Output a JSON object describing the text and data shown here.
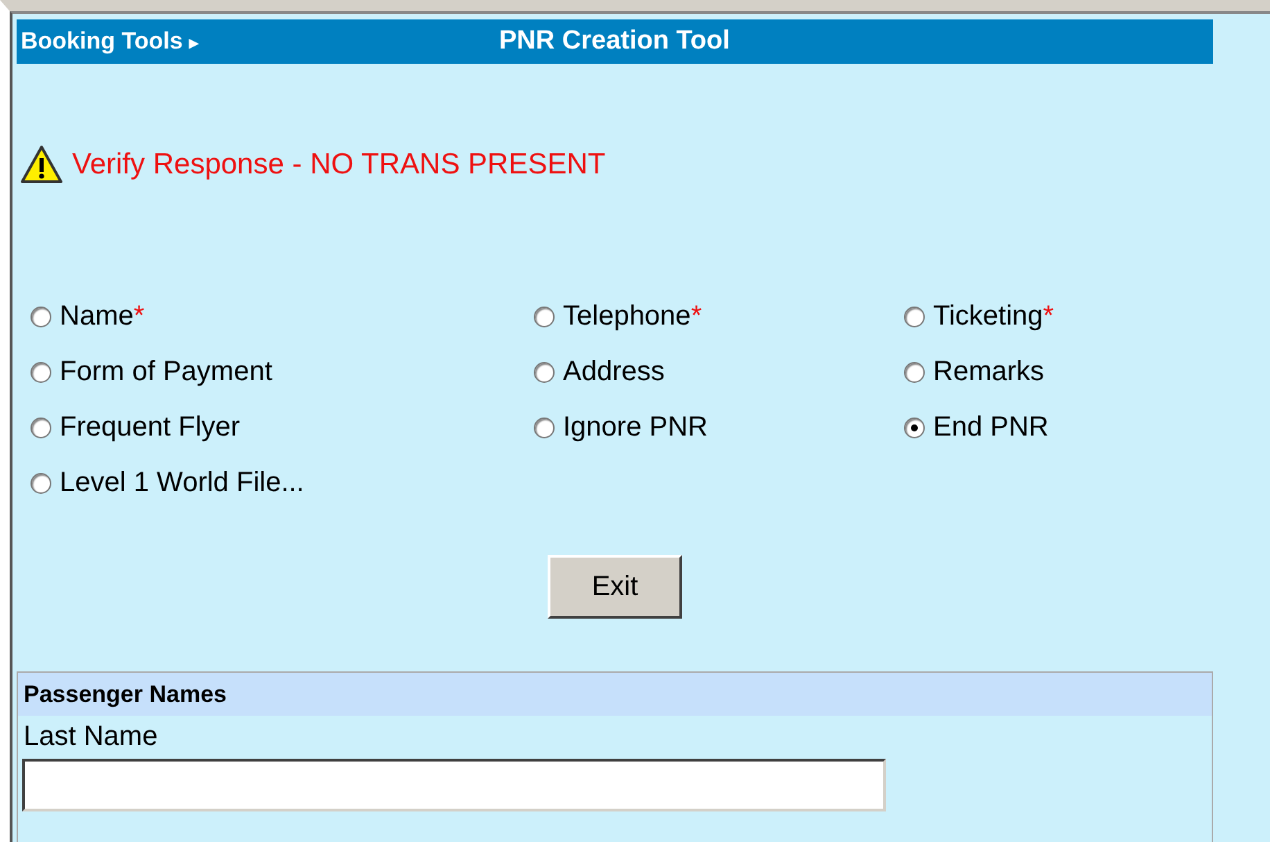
{
  "header": {
    "menu": "Booking Tools",
    "menu_arrow": "▸",
    "title": "PNR Creation Tool"
  },
  "message": {
    "text": "Verify Response - NO TRANS PRESENT"
  },
  "options": [
    {
      "label": "Name",
      "required": true,
      "selected": false
    },
    {
      "label": "Telephone",
      "required": true,
      "selected": false
    },
    {
      "label": "Ticketing",
      "required": true,
      "selected": false
    },
    {
      "label": "Form of Payment",
      "required": false,
      "selected": false
    },
    {
      "label": "Address",
      "required": false,
      "selected": false
    },
    {
      "label": "Remarks",
      "required": false,
      "selected": false
    },
    {
      "label": "Frequent Flyer",
      "required": false,
      "selected": false
    },
    {
      "label": "Ignore PNR",
      "required": false,
      "selected": false
    },
    {
      "label": "End PNR",
      "required": false,
      "selected": true
    },
    {
      "label": "Level 1 World File...",
      "required": false,
      "selected": false
    }
  ],
  "required_mark": "*",
  "buttons": [
    "Exit"
  ],
  "panel": {
    "title": "Passenger Names",
    "fields": [
      {
        "label": "Last Name"
      }
    ]
  }
}
